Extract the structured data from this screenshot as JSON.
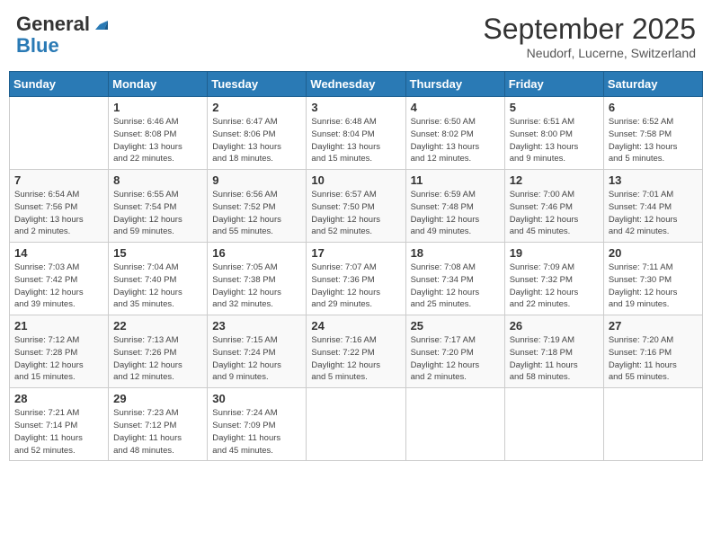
{
  "header": {
    "logo_general": "General",
    "logo_blue": "Blue",
    "month_title": "September 2025",
    "location": "Neudorf, Lucerne, Switzerland"
  },
  "days_of_week": [
    "Sunday",
    "Monday",
    "Tuesday",
    "Wednesday",
    "Thursday",
    "Friday",
    "Saturday"
  ],
  "weeks": [
    [
      {
        "day": "",
        "info": ""
      },
      {
        "day": "1",
        "info": "Sunrise: 6:46 AM\nSunset: 8:08 PM\nDaylight: 13 hours\nand 22 minutes."
      },
      {
        "day": "2",
        "info": "Sunrise: 6:47 AM\nSunset: 8:06 PM\nDaylight: 13 hours\nand 18 minutes."
      },
      {
        "day": "3",
        "info": "Sunrise: 6:48 AM\nSunset: 8:04 PM\nDaylight: 13 hours\nand 15 minutes."
      },
      {
        "day": "4",
        "info": "Sunrise: 6:50 AM\nSunset: 8:02 PM\nDaylight: 13 hours\nand 12 minutes."
      },
      {
        "day": "5",
        "info": "Sunrise: 6:51 AM\nSunset: 8:00 PM\nDaylight: 13 hours\nand 9 minutes."
      },
      {
        "day": "6",
        "info": "Sunrise: 6:52 AM\nSunset: 7:58 PM\nDaylight: 13 hours\nand 5 minutes."
      }
    ],
    [
      {
        "day": "7",
        "info": "Sunrise: 6:54 AM\nSunset: 7:56 PM\nDaylight: 13 hours\nand 2 minutes."
      },
      {
        "day": "8",
        "info": "Sunrise: 6:55 AM\nSunset: 7:54 PM\nDaylight: 12 hours\nand 59 minutes."
      },
      {
        "day": "9",
        "info": "Sunrise: 6:56 AM\nSunset: 7:52 PM\nDaylight: 12 hours\nand 55 minutes."
      },
      {
        "day": "10",
        "info": "Sunrise: 6:57 AM\nSunset: 7:50 PM\nDaylight: 12 hours\nand 52 minutes."
      },
      {
        "day": "11",
        "info": "Sunrise: 6:59 AM\nSunset: 7:48 PM\nDaylight: 12 hours\nand 49 minutes."
      },
      {
        "day": "12",
        "info": "Sunrise: 7:00 AM\nSunset: 7:46 PM\nDaylight: 12 hours\nand 45 minutes."
      },
      {
        "day": "13",
        "info": "Sunrise: 7:01 AM\nSunset: 7:44 PM\nDaylight: 12 hours\nand 42 minutes."
      }
    ],
    [
      {
        "day": "14",
        "info": "Sunrise: 7:03 AM\nSunset: 7:42 PM\nDaylight: 12 hours\nand 39 minutes."
      },
      {
        "day": "15",
        "info": "Sunrise: 7:04 AM\nSunset: 7:40 PM\nDaylight: 12 hours\nand 35 minutes."
      },
      {
        "day": "16",
        "info": "Sunrise: 7:05 AM\nSunset: 7:38 PM\nDaylight: 12 hours\nand 32 minutes."
      },
      {
        "day": "17",
        "info": "Sunrise: 7:07 AM\nSunset: 7:36 PM\nDaylight: 12 hours\nand 29 minutes."
      },
      {
        "day": "18",
        "info": "Sunrise: 7:08 AM\nSunset: 7:34 PM\nDaylight: 12 hours\nand 25 minutes."
      },
      {
        "day": "19",
        "info": "Sunrise: 7:09 AM\nSunset: 7:32 PM\nDaylight: 12 hours\nand 22 minutes."
      },
      {
        "day": "20",
        "info": "Sunrise: 7:11 AM\nSunset: 7:30 PM\nDaylight: 12 hours\nand 19 minutes."
      }
    ],
    [
      {
        "day": "21",
        "info": "Sunrise: 7:12 AM\nSunset: 7:28 PM\nDaylight: 12 hours\nand 15 minutes."
      },
      {
        "day": "22",
        "info": "Sunrise: 7:13 AM\nSunset: 7:26 PM\nDaylight: 12 hours\nand 12 minutes."
      },
      {
        "day": "23",
        "info": "Sunrise: 7:15 AM\nSunset: 7:24 PM\nDaylight: 12 hours\nand 9 minutes."
      },
      {
        "day": "24",
        "info": "Sunrise: 7:16 AM\nSunset: 7:22 PM\nDaylight: 12 hours\nand 5 minutes."
      },
      {
        "day": "25",
        "info": "Sunrise: 7:17 AM\nSunset: 7:20 PM\nDaylight: 12 hours\nand 2 minutes."
      },
      {
        "day": "26",
        "info": "Sunrise: 7:19 AM\nSunset: 7:18 PM\nDaylight: 11 hours\nand 58 minutes."
      },
      {
        "day": "27",
        "info": "Sunrise: 7:20 AM\nSunset: 7:16 PM\nDaylight: 11 hours\nand 55 minutes."
      }
    ],
    [
      {
        "day": "28",
        "info": "Sunrise: 7:21 AM\nSunset: 7:14 PM\nDaylight: 11 hours\nand 52 minutes."
      },
      {
        "day": "29",
        "info": "Sunrise: 7:23 AM\nSunset: 7:12 PM\nDaylight: 11 hours\nand 48 minutes."
      },
      {
        "day": "30",
        "info": "Sunrise: 7:24 AM\nSunset: 7:09 PM\nDaylight: 11 hours\nand 45 minutes."
      },
      {
        "day": "",
        "info": ""
      },
      {
        "day": "",
        "info": ""
      },
      {
        "day": "",
        "info": ""
      },
      {
        "day": "",
        "info": ""
      }
    ]
  ]
}
